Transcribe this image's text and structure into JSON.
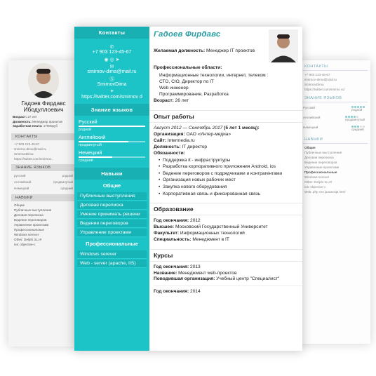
{
  "left_card": {
    "name": "Гадоев Фирдавс Ибодуллоевич",
    "info_lines": [
      {
        "label": "Возраст:",
        "value": "27 лет"
      },
      {
        "label": "Должность:",
        "value": "Менеджер проектов"
      },
      {
        "label": "Заработная плата:",
        "value": "17000руб"
      }
    ],
    "contacts_head": "КОНТАКТЫ",
    "contacts": [
      "+7 903 123-45-67",
      "smirnov-dima@mail.ru",
      "SmirnovDima",
      "https://twitter.com/smirnov..."
    ],
    "langs_head": "ЗНАНИЕ ЯЗЫКОВ",
    "langs": [
      {
        "name": "русский",
        "level": "родной",
        "value": 1.0
      },
      {
        "name": "Английский",
        "level": "продвинутый",
        "value": 0.75
      },
      {
        "name": "Немецкий",
        "level": "средний",
        "value": 0.5
      }
    ],
    "skills_head": "НАВЫКИ",
    "skills_sub1": "Общие",
    "skills_general": [
      "Публичные выступления",
      "Деловая переписка",
      "Ведение переговоров",
      "Управление проектами"
    ],
    "skills_sub2": "Профессиональные",
    "skills_prof": [
      "Windows serever",
      "Other: Delphi 3c,c#",
      "ios: objective-c"
    ]
  },
  "right_card": {
    "contacts_head": "КОНТАКТЫ",
    "contacts": [
      "+7 903 123-45-67",
      "smirnov-dima@mail.ru",
      "SmirnovDima",
      "https://twitter.com/smirno vd"
    ],
    "langs_head": "ЗНАНИЕ ЯЗЫКОВ",
    "langs": [
      {
        "name": "Русский",
        "level": "родной",
        "rating": 5
      },
      {
        "name": "Английский",
        "level": "продвинутый",
        "rating": 4
      },
      {
        "name": "Немецкий",
        "level": "средний",
        "rating": 3
      }
    ],
    "skills_head": "НАВЫКИ",
    "skills_sub1": "Общие",
    "skills_general": [
      "Публичные выступления",
      "Деловая переписка",
      "Ведение переговоров",
      "Управление проектами"
    ],
    "skills_sub2": "Профессиональные",
    "skills_prof": [
      "Windows serever",
      "Other: Delphi 3c,c#",
      "ios: objective-c",
      "Web: php css javascript html"
    ]
  },
  "sidebar": {
    "contacts_head": "Контакты",
    "phone": "+7 903 123-45-67",
    "email": "smirnov-dima@mail.ru",
    "skype": "SmirnovDima",
    "twitter": "https://twitter.com/smirnov d",
    "langs_head": "Знание языков",
    "langs": [
      {
        "name": "Русский",
        "level": "родной",
        "value": 1.0
      },
      {
        "name": "Английский",
        "level": "продвинутый",
        "value": 0.75
      },
      {
        "name": "Немецкий",
        "level": "средний",
        "value": 0.5
      }
    ],
    "skills_head": "Навыки",
    "general_head": "Общие",
    "general": [
      "Публичные выступления",
      "Деловая переписка",
      "Умение принимать решени",
      "Ведение переговоров",
      "Управление проектами"
    ],
    "prof_head": "Профессиональные",
    "prof": [
      "Windows serever",
      "Web - server (apache, IIS)"
    ]
  },
  "content": {
    "name": "Гадоев Фирдавс",
    "desired_label": "Желаемая должность:",
    "desired_value": "Менеджер IT проектов",
    "areas_label": "Профессиональные области:",
    "areas": [
      "Информационные технологии, интернет, телеком :",
      "СТО, CIO, Директор по IT",
      "Web инженер",
      "Программирование, Разработка"
    ],
    "age_label": "Возраст:",
    "age_value": "26 лет",
    "exp_head": "Опыт работы",
    "exp_period": "Август 2012 — Сентябрь 2017",
    "exp_duration": "(5 лет 1 месяц):",
    "org_label": "Организация:",
    "org_value": "ОАО «Интер-медиа»",
    "site_label": "Сайт:",
    "site_value": "Intermedia.ru",
    "pos_label": "Должность:",
    "pos_value": "IT директор",
    "duties_label": "Обязанности:",
    "duties": [
      "Поддержка it - инфраструктуры",
      "Разработка корпоративного приложения Android, ios",
      "Ведение переговоров с подрядчиками и контрагентами",
      "Организация новых рабочих мест",
      "Закупка нового оборудования",
      "Корпоративная связь и фиксированная связь"
    ],
    "edu_head": "Образование",
    "edu_year_label": "Год окончания:",
    "edu_year": "2012",
    "edu_high_label": "Высшее:",
    "edu_high": "Московский Государственный Университет",
    "edu_fac_label": "Факультет:",
    "edu_fac": "Информационных технологий",
    "edu_spec_label": "Специальность:",
    "edu_spec": "Менеджмент в IT",
    "courses_head": "Курсы",
    "c1_year_label": "Год окончания:",
    "c1_year": "2013",
    "c1_name_label": "Название:",
    "c1_name": "Менеджмент web-проектов",
    "c1_org_label": "Поводившая организация:",
    "c1_org": "Учебный центр \"Специалист\"",
    "c2_year_label": "Год окончания:",
    "c2_year": "2014"
  },
  "colors": {
    "accent": "#1cc4c7",
    "accent_dark": "#18b0b3",
    "name_color": "#2a9fa3"
  },
  "icons": [
    "phone-icon",
    "email-icon",
    "skype-icon",
    "twitter-icon"
  ]
}
